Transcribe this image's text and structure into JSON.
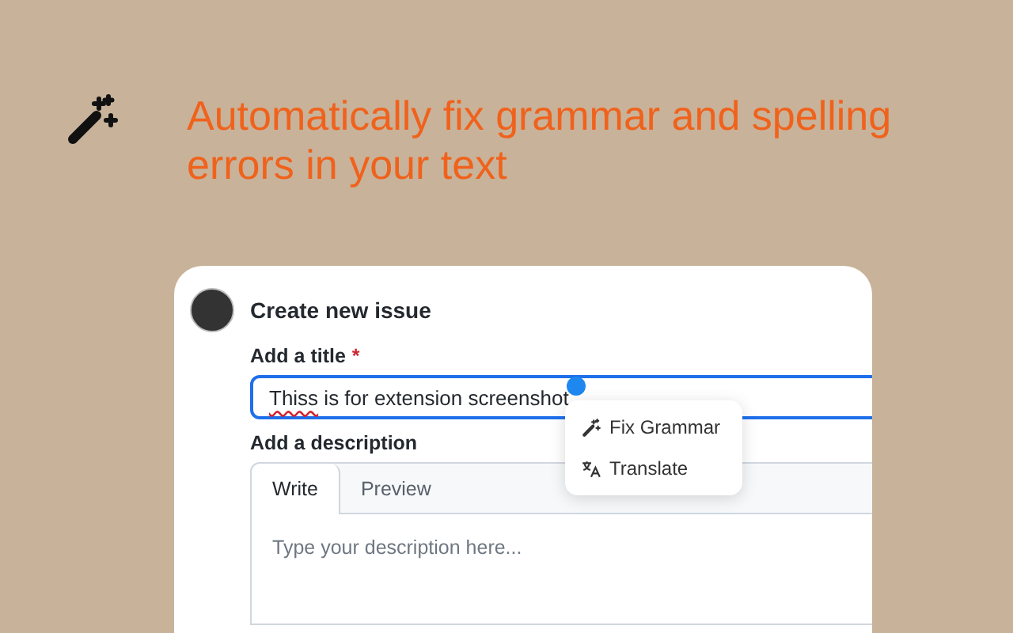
{
  "headline": "Automatically fix grammar and spelling errors in your text",
  "form": {
    "title": "Create new issue",
    "title_label": "Add a title",
    "required_mark": "*",
    "title_value": {
      "misspelled": "Thiss",
      "rest": " is for extension screenshot"
    },
    "description_label": "Add a description",
    "tabs": [
      {
        "label": "Write",
        "selected": true
      },
      {
        "label": "Preview",
        "selected": false
      }
    ],
    "description": {
      "placeholder": "Type your description here..."
    }
  },
  "popup_menu": [
    {
      "kind": "wand",
      "label": "Fix Grammar"
    },
    {
      "kind": "translate",
      "label": "Translate"
    }
  ]
}
